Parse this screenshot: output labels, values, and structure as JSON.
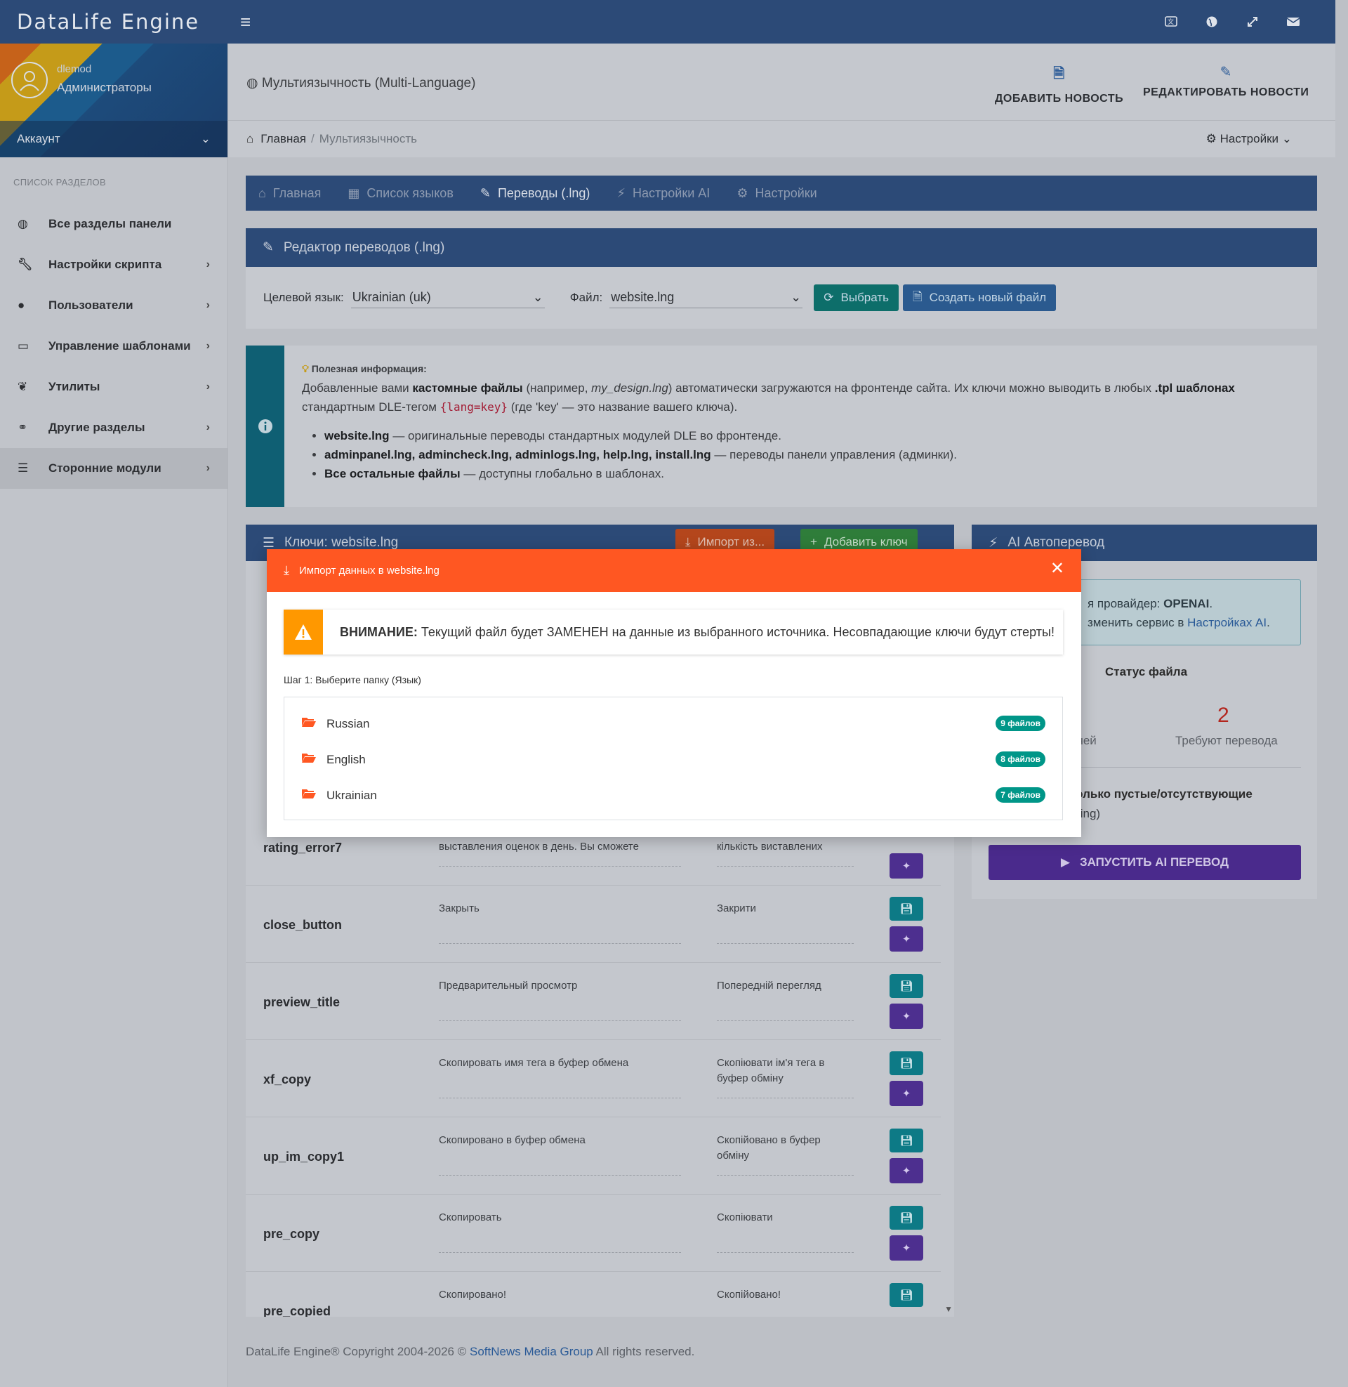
{
  "app": {
    "brand": "DataLife Engine"
  },
  "user": {
    "name": "dlemod",
    "role": "Администраторы",
    "account_label": "Аккаунт"
  },
  "sidebar": {
    "heading": "СПИСОК РАЗДЕЛОВ",
    "items": [
      {
        "label": "Все разделы панели",
        "icon": "globe-icon"
      },
      {
        "label": "Настройки скрипта",
        "icon": "wrench-icon"
      },
      {
        "label": "Пользователи",
        "icon": "user-icon"
      },
      {
        "label": "Управление шаблонами",
        "icon": "laptop-icon"
      },
      {
        "label": "Утилиты",
        "icon": "leaf-icon"
      },
      {
        "label": "Другие разделы",
        "icon": "link-icon"
      },
      {
        "label": "Сторонние модули",
        "icon": "list-icon"
      }
    ]
  },
  "header": {
    "title": "Мультиязычность (Multi-Language)",
    "add_news": "ДОБАВИТЬ НОВОСТЬ",
    "edit_news": "РЕДАКТИРОВАТЬ НОВОСТИ"
  },
  "breadcrumb": {
    "home": "Главная",
    "sep": "/",
    "current": "Мультиязычность",
    "settings": "Настройки"
  },
  "tabs": [
    "Главная",
    "Список языков",
    "Переводы (.lng)",
    "Настройки AI",
    "Настройки"
  ],
  "editor": {
    "title": "Редактор переводов (.lng)",
    "target_label": "Целевой язык:",
    "target_value": "Ukrainian (uk)",
    "file_label": "Файл:",
    "file_value": "website.lng",
    "select_button": "Выбрать",
    "new_file_button": "Создать новый файл"
  },
  "info": {
    "title": "Полезная информация:",
    "p1": "Добавленные вами",
    "p1_bold": "кастомные файлы",
    "p1_a": "(например,",
    "p1_italic": "my_design.lng",
    "p1_b": ") автоматически загружаются на фронтенде сайта. Их ключи можно выводить в любых",
    "p1_bold2": ".tpl шаблонах",
    "p2_a": "стандартным DLE-тегом",
    "p2_code": "{lang=key}",
    "p2_b": "(где 'key' — это название вашего ключа).",
    "li1_bold": "website.lng",
    "li1": "— оригинальные переводы стандартных модулей DLE во фронтенде.",
    "li2_bold": "adminpanel.lng, admincheck.lng, adminlogs.lng, help.lng, install.lng",
    "li2": "— переводы панели управления (админки).",
    "li3_bold": "Все остальные файлы",
    "li3": "— доступны глобально в шаблонах."
  },
  "keys": {
    "title": "Ключи: website.lng",
    "import_button": "Импорт из...",
    "add_key_button": "Добавить ключ",
    "rows": [
      {
        "key": "rating_error7",
        "orig": "выставления оценок в день. Вы сможете",
        "trans": "кількість виставлених"
      },
      {
        "key": "close_button",
        "orig": "Закрыть",
        "trans": "Закрити"
      },
      {
        "key": "preview_title",
        "orig": "Предварительный просмотр",
        "trans": "Попередній перегляд"
      },
      {
        "key": "xf_copy",
        "orig": "Скопировать имя тега в буфер обмена",
        "trans": "Скопіювати ім'я тега в буфер обміну"
      },
      {
        "key": "up_im_copy1",
        "orig": "Скопировано в буфер обмена",
        "trans": "Скопійовано в буфер обміну"
      },
      {
        "key": "pre_copy",
        "orig": "Скопировать",
        "trans": "Скопіювати"
      },
      {
        "key": "pre_copied",
        "orig": "Скопировано!",
        "trans": "Скопійовано!"
      }
    ]
  },
  "ai": {
    "title": "AI Автоперевод",
    "provider_prefix": "я провайдер:",
    "provider": "OPENAI",
    "change_prefix": "зменить сервис в",
    "change_link": "Настройках AI",
    "status_title": "Статус файла",
    "stat_left_label": "чей",
    "stat_count": "2",
    "stat_label": "Требуют перевода",
    "only_empty": "только пустые/отсутствующие",
    "only_empty_sub": "ting)",
    "run_button": "ЗАПУСТИТЬ AI ПЕРЕВОД"
  },
  "footer": {
    "text_a": "DataLife Engine® Copyright 2004-2026 ©",
    "link": "SoftNews Media Group",
    "text_b": "All rights reserved."
  },
  "modal": {
    "title": "Импорт данных в website.lng",
    "warning_bold": "ВНИМАНИЕ:",
    "warning_text": "Текущий файл будет ЗАМЕНЕН на данные из выбранного источника. Несовпадающие ключи будут стерты!",
    "step": "Шаг 1: Выберите папку (Язык)",
    "folders": [
      {
        "name": "Russian",
        "count": "9 файлов"
      },
      {
        "name": "English",
        "count": "8 файлов"
      },
      {
        "name": "Ukrainian",
        "count": "7 файлов"
      }
    ]
  },
  "colors": {
    "primary": "#2c4a77",
    "accent": "#ff5722",
    "teal": "#009688",
    "purple": "#5e35b1",
    "warning": "#ff9800"
  }
}
